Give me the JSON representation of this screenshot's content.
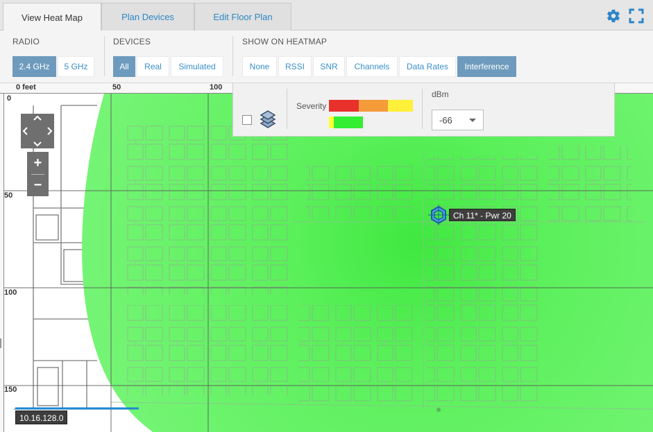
{
  "tabs": [
    {
      "label": "View Heat Map",
      "active": true
    },
    {
      "label": "Plan Devices",
      "active": false
    },
    {
      "label": "Edit Floor Plan",
      "active": false
    }
  ],
  "toolbar_icons": {
    "settings": "gear-icon",
    "fullscreen": "fullscreen-icon"
  },
  "filters": {
    "radio": {
      "label": "RADIO",
      "options": [
        "2.4 GHz",
        "5 GHz"
      ],
      "selected": "2.4 GHz"
    },
    "devices": {
      "label": "DEVICES",
      "options": [
        "All",
        "Real",
        "Simulated"
      ],
      "selected": "All"
    },
    "show": {
      "label": "SHOW ON HEATMAP",
      "options": [
        "None",
        "RSSI",
        "SNR",
        "Channels",
        "Data Rates",
        "Interference"
      ],
      "selected": "Interference"
    }
  },
  "ruler": {
    "top": [
      "0 feet",
      "50",
      "100"
    ],
    "left": [
      "0",
      "50",
      "100",
      "150"
    ]
  },
  "legend": {
    "severity_label": "Severity",
    "severity_colors": [
      "#e8312a",
      "#f59b3a",
      "#fff03a"
    ],
    "coverage_colors": [
      "#ffff33",
      "#33ee33"
    ],
    "dbm_label": "dBm",
    "dbm_value": "-66",
    "layers_icon": "layers-icon"
  },
  "access_point": {
    "label": "Ch 11* - Pwr 20",
    "icon": "access-point-icon"
  },
  "ip_label": "10.16.128.0",
  "colors": {
    "accent": "#2a86c6",
    "active_button": "#6e9bbd",
    "heat": "#5af55a"
  }
}
